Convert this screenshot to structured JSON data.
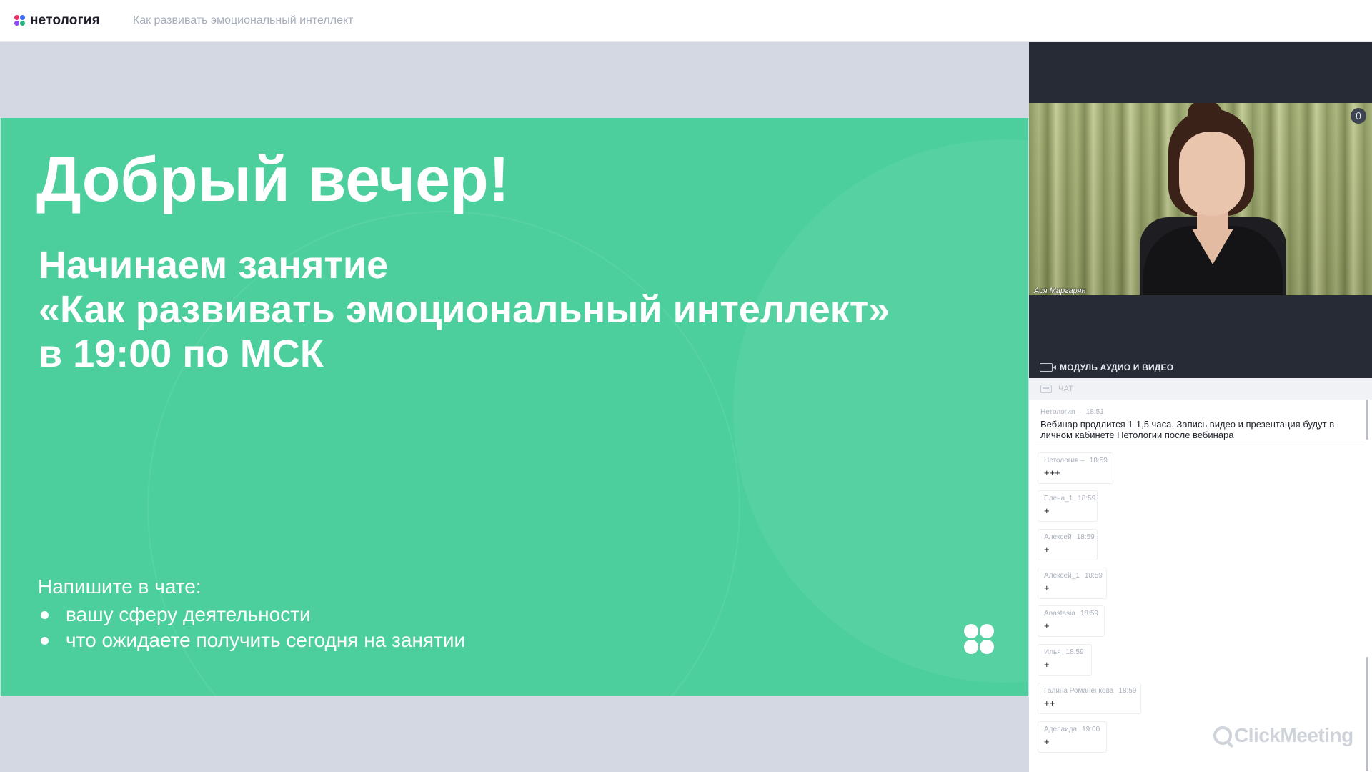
{
  "header": {
    "brand": "нетология",
    "title": "Как развивать эмоциональный интеллект",
    "logo_colors": [
      "#e8336d",
      "#3b6cf5",
      "#8a4cf0",
      "#29b67a"
    ]
  },
  "slide": {
    "greeting": "Добрый вечер!",
    "line1": "Начинаем занятие",
    "line2": "«Как развивать эмоциональный интеллект»",
    "line3": "в 19:00 по МСК",
    "prompt": "Напишите в чате:",
    "bullets": [
      "вашу сферу деятельности",
      "что ожидаете получить сегодня на занятии"
    ],
    "bg_color": "#4ccf9d"
  },
  "video": {
    "speaker": "Ася Маргарян",
    "module_label": "МОДУЛЬ АУДИО И ВИДЕО"
  },
  "chat": {
    "label": "ЧАТ",
    "pinned": {
      "author": "Нетология –",
      "time": "18:51",
      "text": "Вебинар продлится 1-1,5 часа. Запись видео и презентация будут в личном кабинете Нетологии после вебинара"
    },
    "messages": [
      {
        "author": "Нетология –",
        "time": "18:59",
        "text": "+++"
      },
      {
        "author": "Елена_1",
        "time": "18:59",
        "text": "+"
      },
      {
        "author": "Алексей",
        "time": "18:59",
        "text": "+"
      },
      {
        "author": "Алексей_1",
        "time": "18:59",
        "text": "+"
      },
      {
        "author": "Anastasia",
        "time": "18:59",
        "text": "+"
      },
      {
        "author": "Илья",
        "time": "18:59",
        "text": "+"
      },
      {
        "author": "Галина Романенкова",
        "time": "18:59",
        "text": "++"
      },
      {
        "author": "Аделаида",
        "time": "19:00",
        "text": "+"
      }
    ]
  },
  "watermark": "ClickMeeting"
}
